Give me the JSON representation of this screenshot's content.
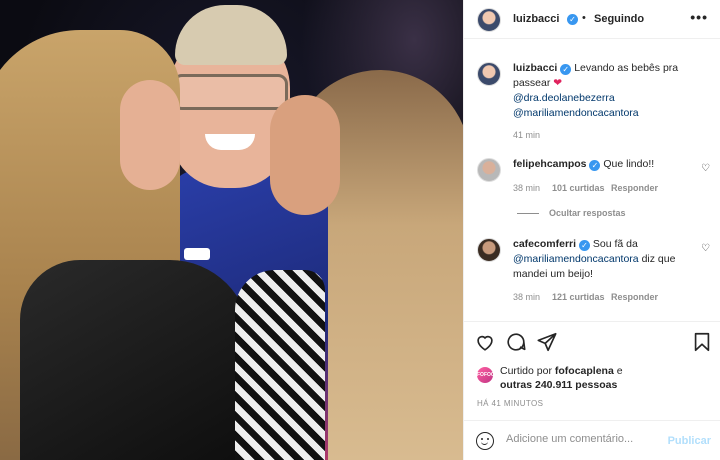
{
  "post": {
    "image_alt": "Foto de três pessoas; duas mulheres beijando o rosto de um homem de óculos e boné",
    "author": "luizbacci",
    "follow_status": "Seguindo",
    "separator": "•",
    "more_label": "•••"
  },
  "caption": {
    "author": "luizbacci",
    "text": "Levando as bebês pra passear",
    "heart": "❤",
    "mention1": "@dra.deolanebezerra",
    "mention2": "@mariliamendoncacantora",
    "time": "41 min"
  },
  "comments": [
    {
      "user": "felipehcampos",
      "text": "Que lindo!!",
      "time": "38 min",
      "likes": "101 curtidas",
      "reply": "Responder"
    },
    {
      "user": "cafecomferri",
      "text": "Sou fã da",
      "mention": "@mariliamendoncacantora",
      "text2": "diz que mandei um beijo!",
      "time": "38 min",
      "likes": "121 curtidas",
      "reply": "Responder"
    }
  ],
  "hide_replies": "Ocultar respostas",
  "likes": {
    "prefix": "Curtido por",
    "user": "fofocaplena",
    "conj": "e",
    "others": "outras 240.911 pessoas",
    "avatar_text": "FOFOCA"
  },
  "timestamp": "HÁ 41 MINUTOS",
  "comment_box": {
    "placeholder": "Adicione um comentário...",
    "publish": "Publicar"
  },
  "icons": [
    "heart-icon",
    "comment-icon",
    "share-icon",
    "save-icon",
    "emoji-icon",
    "more-icon",
    "verified-icon"
  ],
  "colors": {
    "verified": "#3897f0",
    "mention": "#00376b",
    "publish_disabled": "#b2dffc",
    "heart": "#e0245e"
  }
}
